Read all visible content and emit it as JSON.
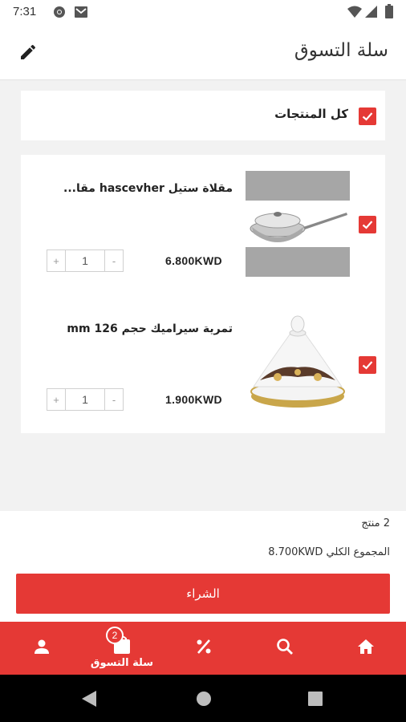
{
  "status_bar": {
    "time": "7:31"
  },
  "header": {
    "title": "سلة التسوق"
  },
  "select_all": {
    "label": "كل المنتجات",
    "checked": true
  },
  "cart_items": [
    {
      "name": "مقلاة ستيل hascevher مقا...",
      "price": "6.800KWD",
      "quantity": "1",
      "checked": true
    },
    {
      "name": "تمرية سيراميك حجم 126 mm",
      "price": "1.900KWD",
      "quantity": "1",
      "checked": true
    }
  ],
  "qty_controls": {
    "minus": "-",
    "plus": "+"
  },
  "summary": {
    "count_text": "2 منتج",
    "total_text": "المجموع الكلي 8.700KWD",
    "buy_label": "الشراء"
  },
  "bottom_nav": {
    "cart_label": "سلة التسوق",
    "cart_badge": "2"
  },
  "colors": {
    "accent": "#e53935"
  }
}
